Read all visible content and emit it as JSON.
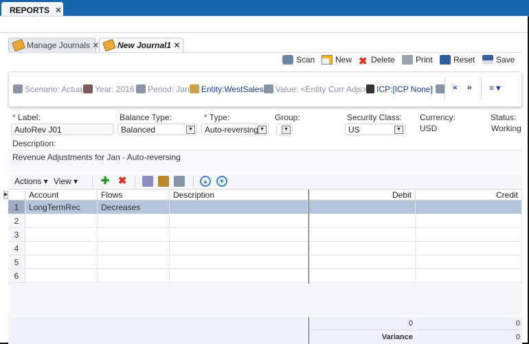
{
  "app_tab": {
    "label": "REPORTS",
    "close": "✕"
  },
  "journal_tabs": [
    {
      "label": "Manage Journals",
      "close": "✕"
    },
    {
      "label": "New Journal1",
      "close": "✕"
    }
  ],
  "toolbar": {
    "scan": "Scan",
    "new": "New",
    "delete": "Delete",
    "print": "Print",
    "reset": "Reset",
    "save": "Save"
  },
  "pov": {
    "scenario": "Scenario: Actual",
    "year": "Year: 2016",
    "period": "Period: Jan",
    "entity": "Entity:WestSales",
    "value": "Value: <Entity Curr Adjs>",
    "icp": "ICP:[ICP None]",
    "prev": "«",
    "next": "»",
    "menu": "≡ ▾"
  },
  "form": {
    "label": {
      "label": "Label:",
      "value": "AutoRev J01"
    },
    "balance_type": {
      "label": "Balance Type:",
      "value": "Balanced"
    },
    "type": {
      "label": "Type:",
      "value": "Auto-reversing"
    },
    "group": {
      "label": "Group:",
      "value": ""
    },
    "security_class": {
      "label": "Security Class:",
      "value": "US"
    },
    "currency": {
      "label": "Currency:",
      "value": "USD"
    },
    "status": {
      "label": "Status:",
      "value": "Working"
    },
    "description": {
      "label": "Description:",
      "value": "Revenue Adjustments for Jan - Auto-reversing"
    },
    "required_mark": "*"
  },
  "grid_toolbar": {
    "actions": "Actions ▾",
    "view": "View ▾"
  },
  "grid": {
    "columns": [
      "Account",
      "Flows",
      "Description",
      "Debit",
      "Credit"
    ],
    "rows": [
      {
        "n": "1",
        "account": "LongTermRec",
        "flows": "Decreases",
        "description": "",
        "debit": "",
        "credit": ""
      },
      {
        "n": "2",
        "account": "",
        "flows": "",
        "description": "",
        "debit": "",
        "credit": ""
      },
      {
        "n": "3",
        "account": "",
        "flows": "",
        "description": "",
        "debit": "",
        "credit": ""
      },
      {
        "n": "4",
        "account": "",
        "flows": "",
        "description": "",
        "debit": "",
        "credit": ""
      },
      {
        "n": "5",
        "account": "",
        "flows": "",
        "description": "",
        "debit": "",
        "credit": ""
      },
      {
        "n": "6",
        "account": "",
        "flows": "",
        "description": "",
        "debit": "",
        "credit": ""
      }
    ],
    "totals": {
      "debit": "0",
      "credit": "0",
      "variance_label": "Variance",
      "variance": "0"
    }
  }
}
